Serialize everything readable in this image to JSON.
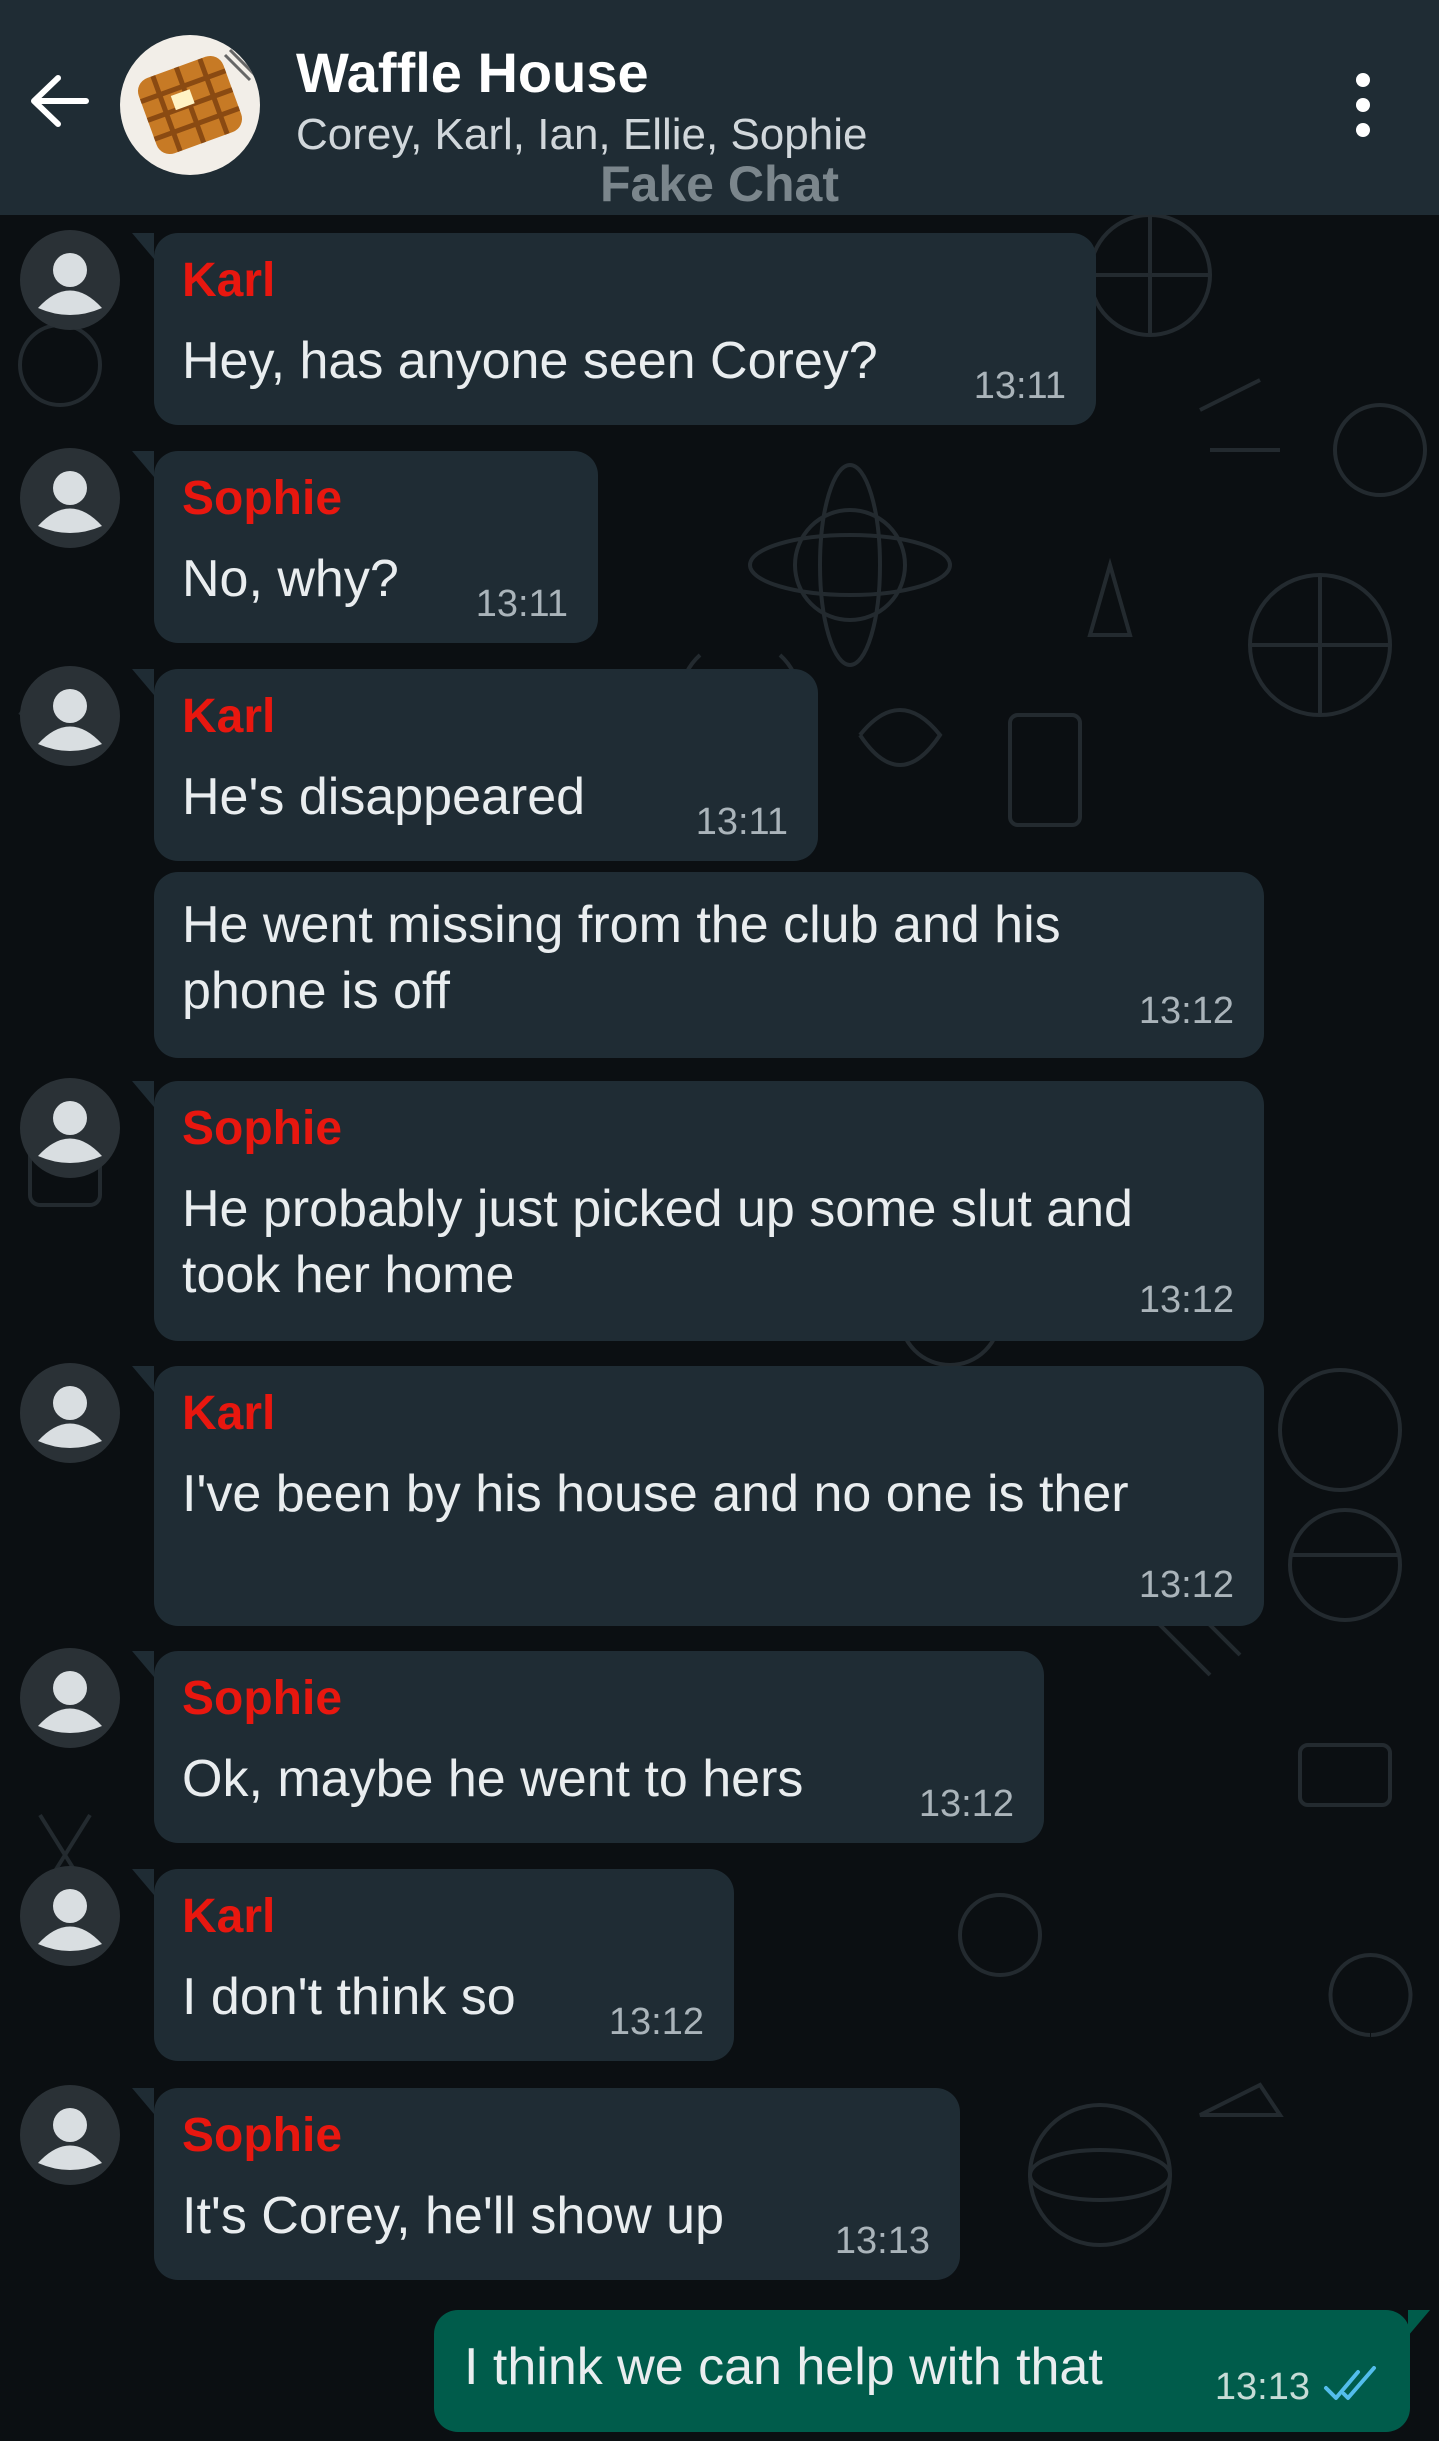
{
  "header": {
    "title": "Waffle House",
    "members": "Corey, Karl, Ian, Ellie, Sophie",
    "watermark": "Fake Chat"
  },
  "colors": {
    "header_bg": "#1f2c34",
    "chat_bg": "#0b0f12",
    "incoming_bubble": "#1f2c34",
    "outgoing_bubble": "#005c4b",
    "sender_name": "#e8170f",
    "read_ticks": "#53bdeb"
  },
  "messages": [
    {
      "sender": "Karl",
      "text": "Hey, has anyone seen Corey?",
      "time": "13:11"
    },
    {
      "sender": "Sophie",
      "text": "No, why?",
      "time": "13:11"
    },
    {
      "sender": "Karl",
      "text": "He's disappeared",
      "time": "13:11"
    },
    {
      "sender": "",
      "text_lines": [
        "He went missing from the club and his",
        "phone is off"
      ],
      "time": "13:12"
    },
    {
      "sender": "Sophie",
      "text_lines": [
        "He probably just picked up some slut and",
        "took her home"
      ],
      "time": "13:12"
    },
    {
      "sender": "Karl",
      "text": "I've been by his house and no one is ther",
      "time": "13:12"
    },
    {
      "sender": "Sophie",
      "text": "Ok, maybe he went to hers",
      "time": "13:12"
    },
    {
      "sender": "Karl",
      "text": "I don't think so",
      "time": "13:12"
    },
    {
      "sender": "Sophie",
      "text": "It's Corey, he'll show up",
      "time": "13:13"
    },
    {
      "sender": "me",
      "text": "I think we can help with that",
      "time": "13:13",
      "status": "read"
    }
  ]
}
